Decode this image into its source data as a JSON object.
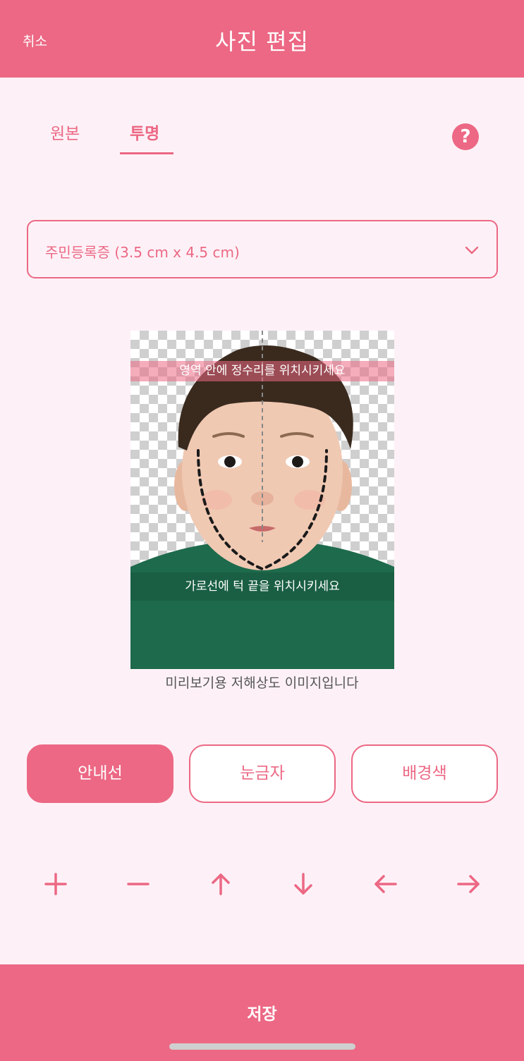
{
  "header": {
    "cancel_label": "취소",
    "title": "사진 편집"
  },
  "tabs": [
    {
      "label": "원본"
    },
    {
      "label": "투명"
    }
  ],
  "active_tab": "투명",
  "help": {
    "label": "?"
  },
  "size_select": {
    "selected": "주민등록증 (3.5 cm x 4.5 cm)"
  },
  "photo": {
    "top_guide": "영역 안에 정수리를 위치시키세요",
    "bottom_guide": "가로선에 턱 끝을 위치시키세요",
    "caption": "미리보기용 저해상도 이미지입니다"
  },
  "options": [
    {
      "label": "안내선"
    },
    {
      "label": "눈금자"
    },
    {
      "label": "배경색"
    }
  ],
  "active_option": "안내선",
  "save": {
    "label": "저장"
  },
  "colors": {
    "accent": "#EC6884",
    "background": "#FDF1F7"
  }
}
